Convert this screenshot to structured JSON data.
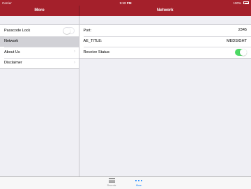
{
  "status_bar": {
    "carrier": "Carrier",
    "time": "1:12 PM",
    "battery": "100%"
  },
  "master": {
    "title": "More",
    "items": [
      {
        "label": "Passcode Lock",
        "accessory": "toggle",
        "toggle_on": false
      },
      {
        "label": "Network",
        "accessory": "none",
        "selected": true
      },
      {
        "label": "About Us",
        "accessory": "chevron"
      },
      {
        "label": "Disclaimer",
        "accessory": "chevron"
      }
    ]
  },
  "detail": {
    "title": "Network",
    "rows": [
      {
        "label": "Port:",
        "value": "2345"
      },
      {
        "label": "AE_TITLE:",
        "value": "MEDSIGHT"
      },
      {
        "label": "Receive Status:",
        "toggle_on": true
      }
    ]
  },
  "tab_bar": {
    "tabs": [
      {
        "label": "Recents",
        "icon": "list-icon",
        "active": false
      },
      {
        "label": "More",
        "icon": "more-dots-icon",
        "active": true
      }
    ]
  },
  "colors": {
    "navbar": "#a4202b",
    "accent": "#007aff",
    "toggle_on": "#4cd964"
  }
}
